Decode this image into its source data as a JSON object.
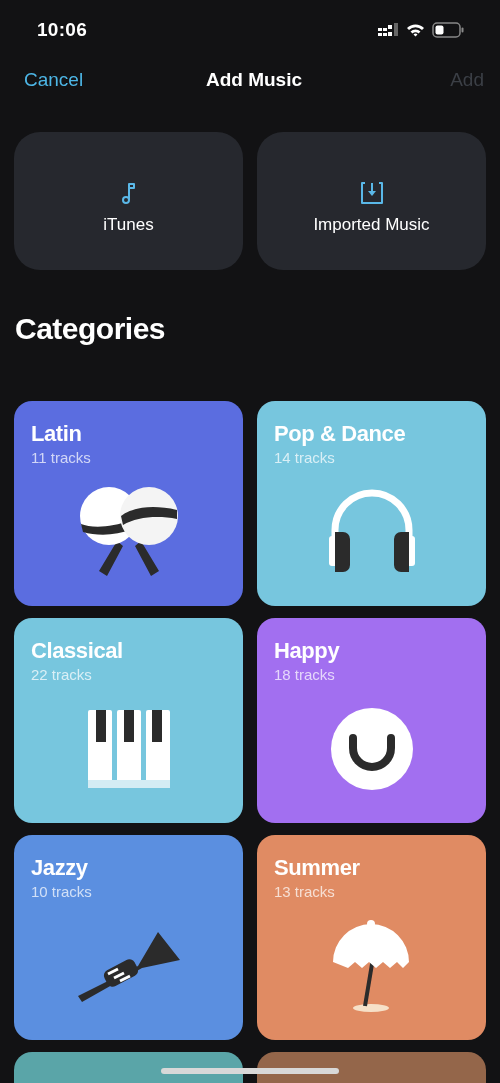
{
  "status_bar": {
    "time": "10:06"
  },
  "nav": {
    "cancel": "Cancel",
    "title": "Add Music",
    "add": {
      "label": "Add",
      "disabled": true
    }
  },
  "sources": [
    {
      "label": "iTunes",
      "kind": "note"
    },
    {
      "label": "Imported Music",
      "kind": "import"
    }
  ],
  "categories_heading": "Categories",
  "categories": [
    {
      "title": "Latin",
      "count": "11 tracks",
      "color": "#5b6de0"
    },
    {
      "title": "Pop & Dance",
      "count": "14 tracks",
      "color": "#77c6de"
    },
    {
      "title": "Classical",
      "count": "22 tracks",
      "color": "#77c6de"
    },
    {
      "title": "Happy",
      "count": "18 tracks",
      "color": "#a26ff0"
    },
    {
      "title": "Jazzy",
      "count": "10 tracks",
      "color": "#5b8fe0"
    },
    {
      "title": "Summer",
      "count": "13 tracks",
      "color": "#e08b63"
    },
    {
      "color": "#5aa5a8"
    },
    {
      "color": "#94664a"
    }
  ]
}
